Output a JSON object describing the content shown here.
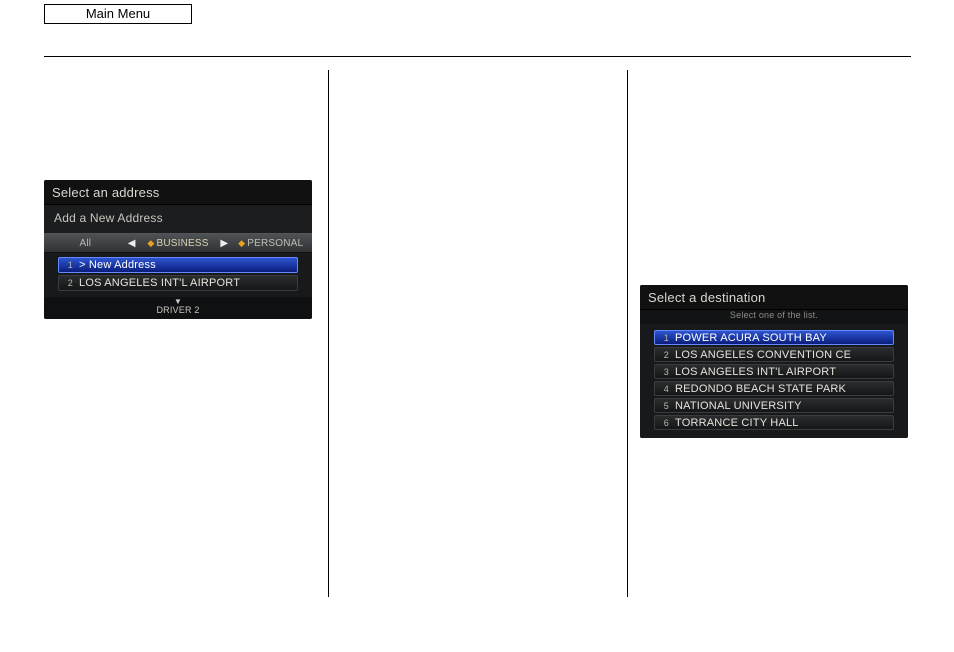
{
  "header": {
    "main_menu": "Main Menu"
  },
  "screen_address": {
    "title": "Select an address",
    "subtitle": "Add a New Address",
    "tabs": {
      "all": "All",
      "business": "BUSINESS",
      "personal": "PERSONAL"
    },
    "rows": [
      {
        "num": "1",
        "label": "> New Address",
        "highlight": true
      },
      {
        "num": "2",
        "label": "LOS ANGELES INT'L AIRPORT",
        "highlight": false
      }
    ],
    "footer": "DRIVER 2"
  },
  "screen_destination": {
    "title": "Select a destination",
    "subtitle": "Select one of the list.",
    "rows": [
      {
        "num": "1",
        "label": "POWER ACURA SOUTH BAY",
        "highlight": true
      },
      {
        "num": "2",
        "label": "LOS ANGELES CONVENTION CE",
        "highlight": false
      },
      {
        "num": "3",
        "label": "LOS ANGELES INT'L AIRPORT",
        "highlight": false
      },
      {
        "num": "4",
        "label": "REDONDO BEACH STATE PARK",
        "highlight": false
      },
      {
        "num": "5",
        "label": "NATIONAL UNIVERSITY",
        "highlight": false
      },
      {
        "num": "6",
        "label": "TORRANCE CITY HALL",
        "highlight": false
      }
    ]
  }
}
